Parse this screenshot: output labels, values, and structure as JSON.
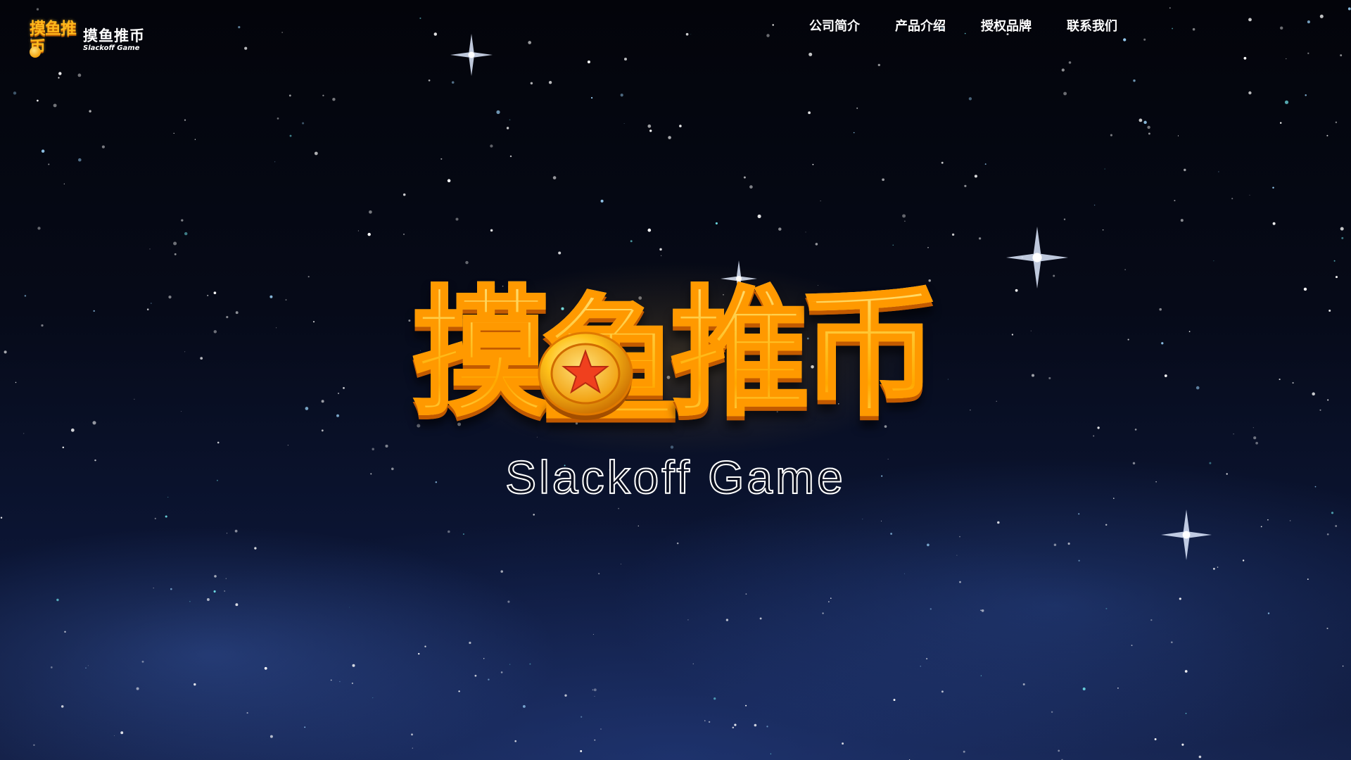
{
  "site": {
    "brand": {
      "logo_mark_text": "摸鱼推币",
      "name_cn": "摸鱼推币",
      "name_en": "Slackoff Game"
    },
    "nav": {
      "items": [
        {
          "label": "公司简介"
        },
        {
          "label": "产品介绍"
        },
        {
          "label": "授权品牌"
        },
        {
          "label": "联系我们"
        }
      ]
    }
  },
  "hero": {
    "title_chars": [
      "摸",
      "鱼",
      "推",
      "币"
    ],
    "subtitle": "Slackoff Game",
    "icons": [
      "gold-coin-star-icon"
    ]
  },
  "colors": {
    "background_top": "#03040a",
    "background_bottom": "#15224a",
    "title_gold": "#ffc21a",
    "title_stroke": "#ff9900",
    "nav_text": "#ffffff"
  }
}
